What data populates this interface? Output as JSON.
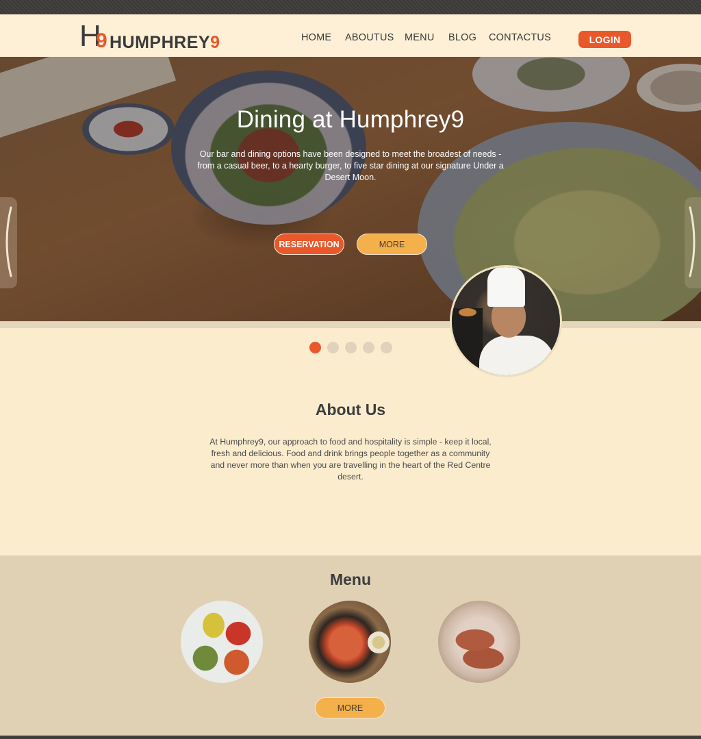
{
  "brand": {
    "logo_mark_letter": "H",
    "logo_mark_digit": "9",
    "logo_name": "HUMPHREY",
    "logo_digit": "9",
    "accent_color": "#e8582b",
    "secondary_color": "#f4b04a"
  },
  "nav": {
    "items": [
      {
        "label": "HOME"
      },
      {
        "label": "ABOUTUS"
      },
      {
        "label": "MENU"
      },
      {
        "label": "BLOG"
      },
      {
        "label": "CONTACTUS"
      }
    ],
    "login_label": "LOGIN"
  },
  "hero": {
    "title": "Dining at Humphrey9",
    "description": "Our bar and dining options have been designed to meet the broadest of needs - from a casual beer, to a hearty burger, to five star dining at our signature Under a Desert Moon.",
    "reservation_label": "RESERVATION",
    "more_label": "MORE",
    "slides_total": 5,
    "active_slide": 1
  },
  "about": {
    "title": "About Us",
    "text": "At Humphrey9, our approach to food and hospitality is simple - keep it local, fresh and delicious. Food and drink brings people together as a community and never more than when you are travelling in the heart of the Red Centre desert."
  },
  "menu": {
    "title": "Menu",
    "dishes": [
      {
        "icon": "pasta-nests-image"
      },
      {
        "icon": "hot-pot-image"
      },
      {
        "icon": "grilled-meat-image"
      }
    ],
    "more_label": "MORE"
  }
}
